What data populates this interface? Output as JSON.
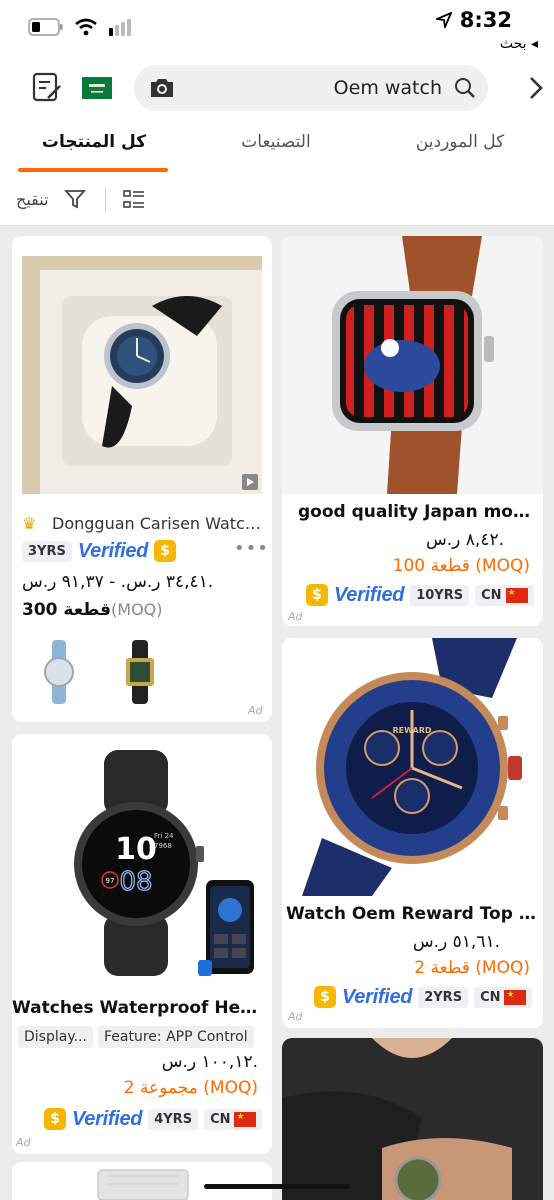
{
  "status": {
    "time": "8:32",
    "back_label": "بحث ◂"
  },
  "header": {
    "search_value": "Oem watch"
  },
  "tabs": [
    {
      "label": "كل المنتجات",
      "active": true
    },
    {
      "label": "التصنيعات",
      "active": false
    },
    {
      "label": "كل الموردين",
      "active": false
    }
  ],
  "filter": {
    "label": "تنقيح"
  },
  "cards": [
    {
      "supplier": "Dongguan Carisen Watch...",
      "price": "٣٤,٤١ ر.س. - ٩١,٣٧ ر.س.",
      "moq_value": "300 قطعة",
      "moq_label": "(MOQ)",
      "years": "3YRS",
      "verified": "Verified",
      "ad": "Ad"
    },
    {
      "title": "good quality Japan move...",
      "price": "٨,٤٢ ر.س.",
      "moq": "100 قطعة (MOQ)",
      "years": "10YRS",
      "country": "CN",
      "verified": "Verified",
      "ad": "Ad"
    },
    {
      "title": "Watches Waterproof Heart...",
      "features": [
        "Feature: APP Control",
        "Display..."
      ],
      "price": "١٠٠,١٢ ر.س.",
      "moq": "2 مجموعة (MOQ)",
      "years": "4YRS",
      "country": "CN",
      "verified": "Verified",
      "ad": "Ad"
    },
    {
      "title": "Watch Oem Reward Top Br...",
      "price": "٥١,٦١ ر.س.",
      "moq": "2 قطعة (MOQ)",
      "years": "2YRS",
      "country": "CN",
      "verified": "Verified",
      "ad": "Ad"
    }
  ],
  "smartwatch_face": {
    "time": "10",
    "time2": "08",
    "date": "Fri 24",
    "steps": "7968",
    "hr": "97"
  },
  "reward_brand": "REWARD",
  "colors": {
    "accent": "#ff6a00",
    "verified_blue": "#2f6fe0",
    "coin_gold": "#f5b700"
  }
}
